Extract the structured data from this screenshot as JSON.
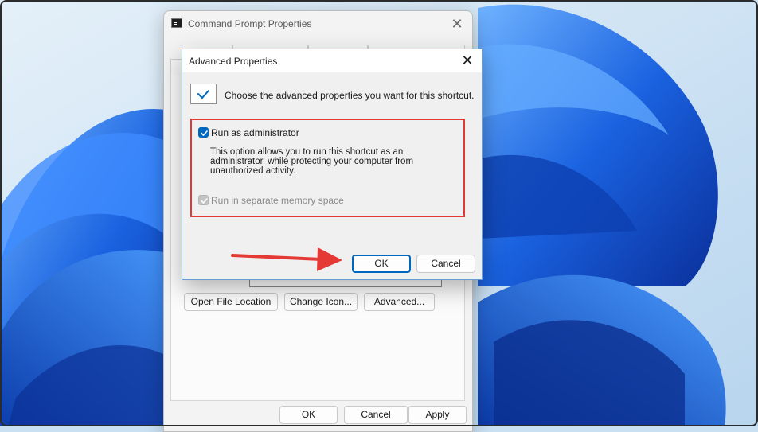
{
  "main_window": {
    "title": "Command Prompt Properties",
    "close_glyph": "✕",
    "buttons": {
      "open_file_location": "Open File Location",
      "change_icon": "Change Icon...",
      "advanced": "Advanced...",
      "ok": "OK",
      "cancel": "Cancel",
      "apply": "Apply"
    }
  },
  "dialog": {
    "title": "Advanced Properties",
    "close_glyph": "✕",
    "intro": "Choose the advanced properties you want for this shortcut.",
    "run_as_admin": {
      "label": "Run as administrator",
      "checked": true,
      "description_lines": [
        "This option allows you to run this shortcut as an",
        "administrator, while protecting your computer from",
        "unauthorized activity."
      ]
    },
    "separate_memory": {
      "label": "Run in separate memory space",
      "checked": true,
      "enabled": false
    },
    "ok": "OK",
    "cancel": "Cancel"
  },
  "colors": {
    "accent": "#0067c0",
    "highlight": "#e53935",
    "arrow": "#e53935",
    "wallpaper_bg": "#c9e0f2",
    "bloom": "#1b5fd1"
  },
  "icons": {
    "window_icon": "cmd-icon",
    "check": "check-icon",
    "close": "close-icon",
    "arrow": "arrow-right-icon"
  }
}
